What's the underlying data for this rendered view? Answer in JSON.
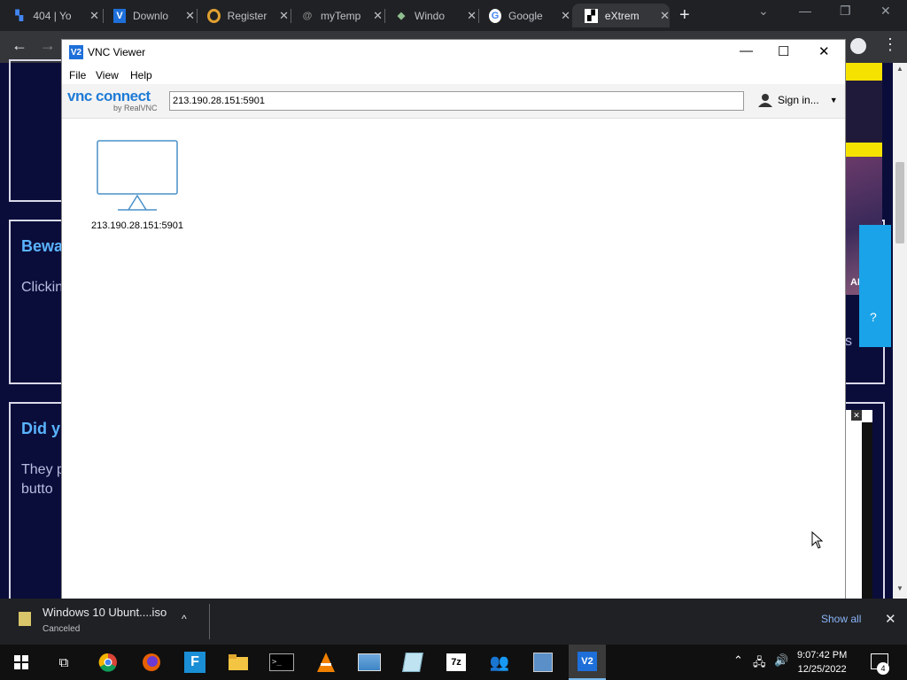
{
  "browser": {
    "tabs": [
      {
        "title": "404 | Yo",
        "favicon": "generic-page"
      },
      {
        "title": "Downlo",
        "favicon": "vnc"
      },
      {
        "title": "Register",
        "favicon": "colored-circle"
      },
      {
        "title": "myTemp",
        "favicon": "mail"
      },
      {
        "title": "Windo",
        "favicon": "windows-shell"
      },
      {
        "title": "Google",
        "favicon": "google"
      },
      {
        "title": "eXtrem",
        "favicon": "checkered"
      }
    ],
    "active_tab_index": 6
  },
  "background_page": {
    "card1_heading": "Bewa",
    "card1_text": "Clickin",
    "card2_heading": "Did y",
    "card2_text_line1": "They p",
    "card2_text_line2": "butto",
    "ads_label": "ADS",
    "partial_s": "s"
  },
  "vnc": {
    "window_title": "VNC Viewer",
    "menu": [
      "File",
      "View",
      "Help"
    ],
    "brand_main": "vnc connect",
    "brand_sub": "by RealVNC",
    "address_value": "213.190.28.151:5901",
    "sign_in_label": "Sign in...",
    "connection_label": "213.190.28.151:5901"
  },
  "download_bar": {
    "file_name": "Windows 10 Ubunt....iso",
    "status": "Canceled",
    "show_all_label": "Show all"
  },
  "taskbar": {
    "time": "9:07:42 PM",
    "date": "12/25/2022",
    "notification_count": "4"
  },
  "colors": {
    "page_bg": "#0a0d3a",
    "heading": "#5ab4ff",
    "accent_blue": "#1e6fd9",
    "chrome_dark": "#202124"
  }
}
